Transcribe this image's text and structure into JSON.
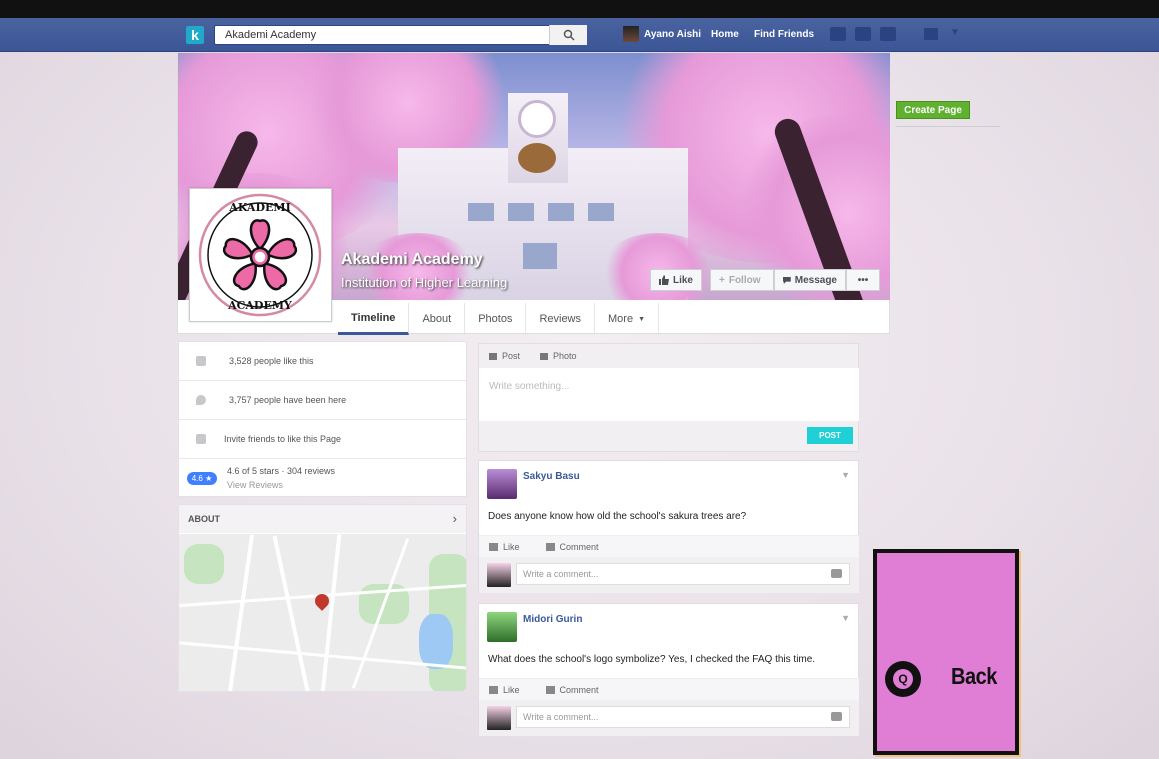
{
  "topbar": {
    "search_value": "Akademi Academy",
    "user_name": "Ayano Aishi",
    "home_label": "Home",
    "find_friends_label": "Find Friends",
    "logo_letter": "k"
  },
  "page": {
    "name": "Akademi Academy",
    "subtitle": "Institution of Higher Learning",
    "logo_text_top": "AKADEMI",
    "logo_text_bottom": "ACADEMY",
    "buttons": {
      "like": "Like",
      "follow": "Follow",
      "message": "Message",
      "more": "•••"
    },
    "tabs": [
      "Timeline",
      "About",
      "Photos",
      "Reviews",
      "More"
    ],
    "create_page": "Create Page"
  },
  "info": {
    "likes": "3,528 people like this",
    "visits": "3,757 people have been here",
    "invite": "Invite friends to like this Page",
    "rating_badge": "4.6 ★",
    "rating": "4.6 of 5 stars · 304 reviews",
    "view_reviews": "View Reviews"
  },
  "about": {
    "title": "ABOUT"
  },
  "composer": {
    "post_tab": "Post",
    "photo_tab": "Photo",
    "placeholder": "Write something...",
    "post_button": "POST"
  },
  "posts": [
    {
      "author": "Sakyu Basu",
      "text": "Does anyone know how old the school's sakura trees are?",
      "like": "Like",
      "comment": "Comment",
      "comment_placeholder": "Write a comment..."
    },
    {
      "author": "Midori Gurin",
      "text": "What does the school's logo symbolize? Yes, I checked the FAQ this time.",
      "like": "Like",
      "comment": "Comment",
      "comment_placeholder": "Write a comment..."
    }
  ],
  "overlay": {
    "key": "Q",
    "label": "Back"
  },
  "colors": {
    "topbar": "#3b5596",
    "accent_cyan": "#1fd0d6",
    "create_green": "#5fb12f",
    "back_panel": "#e07dd4"
  }
}
